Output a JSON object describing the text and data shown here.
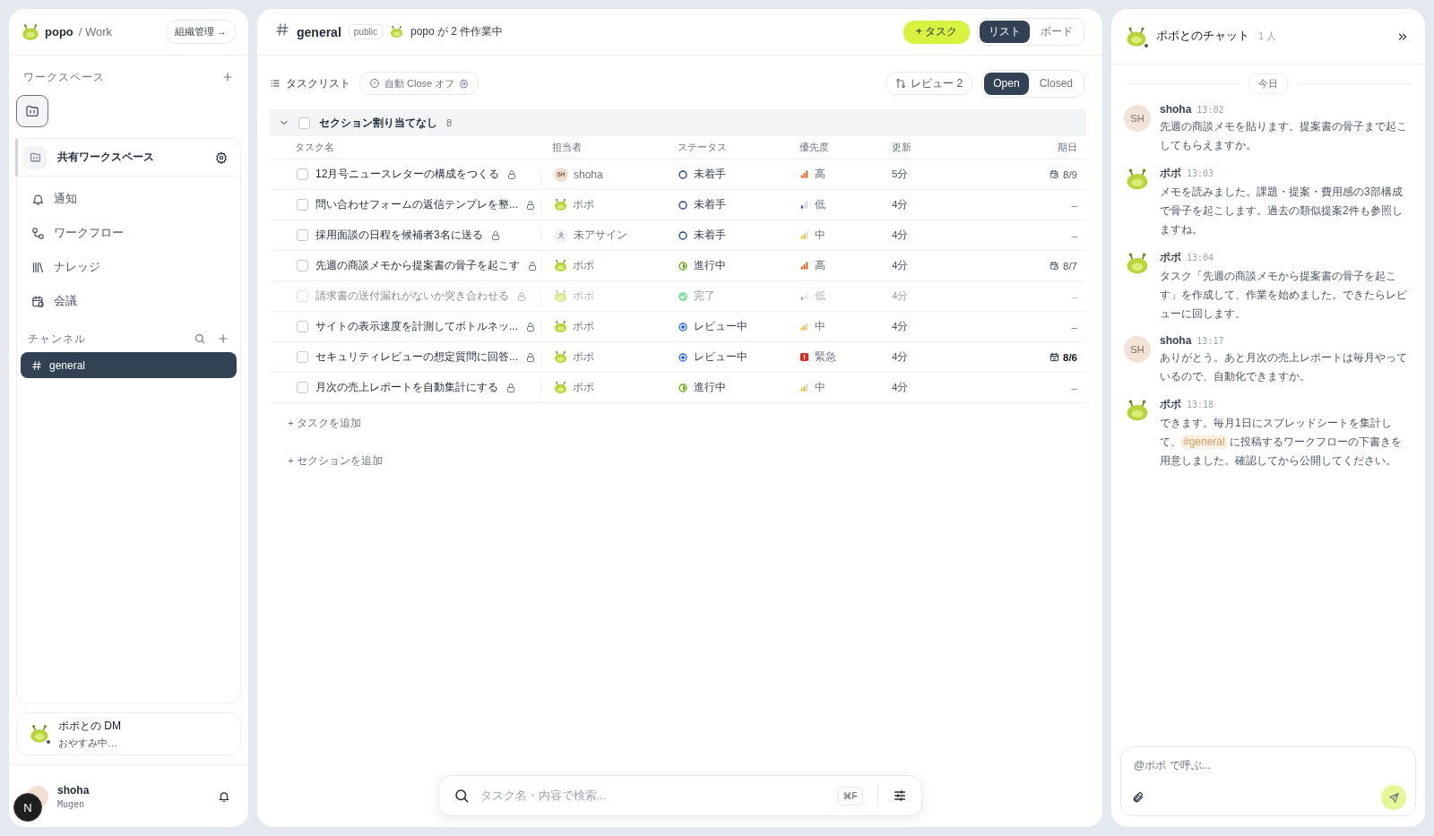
{
  "sidebar": {
    "brand": "popo",
    "workspace_path": "/ Work",
    "org_button": "組織管理 →",
    "workspaces_label": "ワークスペース",
    "workspace": {
      "name": "共有ワークスペース"
    },
    "nav": [
      {
        "label": "通知",
        "selected": false
      },
      {
        "label": "ワークフロー",
        "selected": false
      },
      {
        "label": "ナレッジ",
        "selected": false
      },
      {
        "label": "会議",
        "selected": false
      }
    ],
    "channels_label": "チャンネル",
    "channels": [
      {
        "label": "general",
        "selected": true
      }
    ],
    "dm": {
      "title": "ポポとの DM",
      "status": "おやすみ中…"
    },
    "user": {
      "name": "shoha",
      "org": "Mugen"
    },
    "dev_badge": "N"
  },
  "channel": {
    "name": "general",
    "visibility": "public",
    "activity": "popo が 2 件作業中",
    "new_task": "+ タスク",
    "views": [
      {
        "label": "リスト",
        "selected": true
      },
      {
        "label": "ボード",
        "selected": false
      }
    ]
  },
  "toolbar": {
    "title": "タスクリスト",
    "auto_close": "自動 Close オフ",
    "review": "レビュー 2",
    "filters": [
      {
        "label": "Open",
        "selected": true
      },
      {
        "label": "Closed",
        "selected": false
      }
    ]
  },
  "section": {
    "title": "セクション割り当てなし",
    "count": "8",
    "expanded": true,
    "checked": false
  },
  "columns": [
    "タスク名",
    "担当者",
    "ステータス",
    "優先度",
    "更新",
    "期日"
  ],
  "tasks": [
    {
      "name": "12月号ニュースレターの構成をつくる",
      "checked": false,
      "done": false,
      "assignee": {
        "name": "shoha",
        "kind": "user",
        "initials": "SH"
      },
      "status": {
        "label": "未着手",
        "kind": "todo"
      },
      "priority": {
        "label": "高",
        "kind": "high"
      },
      "updated": "5分",
      "due": {
        "text": "8/9",
        "kind": "date"
      }
    },
    {
      "name": "問い合わせフォームの返信テンプレを整...",
      "checked": false,
      "done": false,
      "assignee": {
        "name": "ポポ",
        "kind": "bot"
      },
      "status": {
        "label": "未着手",
        "kind": "todo"
      },
      "priority": {
        "label": "低",
        "kind": "low"
      },
      "updated": "4分",
      "due": {
        "text": "–",
        "kind": "none"
      }
    },
    {
      "name": "採用面談の日程を候補者3名に送る",
      "checked": false,
      "done": false,
      "assignee": {
        "name": "未アサイン",
        "kind": "unassigned"
      },
      "status": {
        "label": "未着手",
        "kind": "todo"
      },
      "priority": {
        "label": "中",
        "kind": "mid"
      },
      "updated": "4分",
      "due": {
        "text": "–",
        "kind": "none"
      }
    },
    {
      "name": "先週の商談メモから提案書の骨子を起こす",
      "checked": false,
      "done": false,
      "assignee": {
        "name": "ポポ",
        "kind": "bot"
      },
      "status": {
        "label": "進行中",
        "kind": "progress"
      },
      "priority": {
        "label": "高",
        "kind": "high"
      },
      "updated": "4分",
      "due": {
        "text": "8/7",
        "kind": "date"
      }
    },
    {
      "name": "請求書の送付漏れがないか突き合わせる",
      "checked": false,
      "done": true,
      "assignee": {
        "name": "ポポ",
        "kind": "bot"
      },
      "status": {
        "label": "完了",
        "kind": "done"
      },
      "priority": {
        "label": "低",
        "kind": "low"
      },
      "updated": "4分",
      "due": {
        "text": "–",
        "kind": "none"
      }
    },
    {
      "name": "サイトの表示速度を計測してボトルネッ...",
      "checked": false,
      "done": false,
      "assignee": {
        "name": "ポポ",
        "kind": "bot"
      },
      "status": {
        "label": "レビュー中",
        "kind": "review"
      },
      "priority": {
        "label": "中",
        "kind": "mid"
      },
      "updated": "4分",
      "due": {
        "text": "–",
        "kind": "none"
      }
    },
    {
      "name": "セキュリティレビューの想定質問に回答...",
      "checked": false,
      "done": false,
      "assignee": {
        "name": "ポポ",
        "kind": "bot"
      },
      "status": {
        "label": "レビュー中",
        "kind": "review"
      },
      "priority": {
        "label": "緊急",
        "kind": "urgent"
      },
      "updated": "4分",
      "due": {
        "text": "8/6",
        "kind": "overdue"
      }
    },
    {
      "name": "月次の売上レポートを自動集計にする",
      "checked": false,
      "done": false,
      "assignee": {
        "name": "ポポ",
        "kind": "bot"
      },
      "status": {
        "label": "進行中",
        "kind": "progress"
      },
      "priority": {
        "label": "中",
        "kind": "mid"
      },
      "updated": "4分",
      "due": {
        "text": "–",
        "kind": "none"
      }
    }
  ],
  "add_task": "+ タスクを追加",
  "add_section": "+ セクションを追加",
  "search": {
    "placeholder": "タスク名・内容で検索...",
    "shortcut": "⌘F"
  },
  "chat": {
    "title": "ポポとのチャット",
    "members": "1 人",
    "date": "今日",
    "messages": [
      {
        "author": "shoha",
        "kind": "user",
        "initials": "SH",
        "time": "13:02",
        "parts": [
          {
            "kind": "plain",
            "text": "先週の商談メモを貼ります。提案書の骨子まで起こしてもらえますか。"
          }
        ]
      },
      {
        "author": "ポポ",
        "kind": "bot",
        "time": "13:03",
        "parts": [
          {
            "kind": "plain",
            "text": "メモを読みました。課題・提案・費用感の3部構成で骨子を起こします。過去の類似提案2件も参照しますね。"
          }
        ]
      },
      {
        "author": "ポポ",
        "kind": "bot",
        "time": "13:04",
        "parts": [
          {
            "kind": "plain",
            "text": "タスク「先週の商談メモから提案書の骨子を起こす」を作成して、作業を始めました。できたらレビューに回します。"
          }
        ]
      },
      {
        "author": "shoha",
        "kind": "user",
        "initials": "SH",
        "time": "13:17",
        "parts": [
          {
            "kind": "plain",
            "text": "ありがとう。あと月次の売上レポートは毎月やっているので、自動化できますか。"
          }
        ]
      },
      {
        "author": "ポポ",
        "kind": "bot",
        "time": "13:18",
        "parts": [
          {
            "kind": "plain",
            "text": "できます。毎月1日にスプレッドシートを集計して、"
          },
          {
            "kind": "mention",
            "text": "#general"
          },
          {
            "kind": "plain",
            "text": " に投稿するワークフローの下書きを用意しました。確認してから公開してください。"
          }
        ]
      }
    ],
    "composer": {
      "placeholder": "@ポポ で呼ぶ..."
    }
  }
}
